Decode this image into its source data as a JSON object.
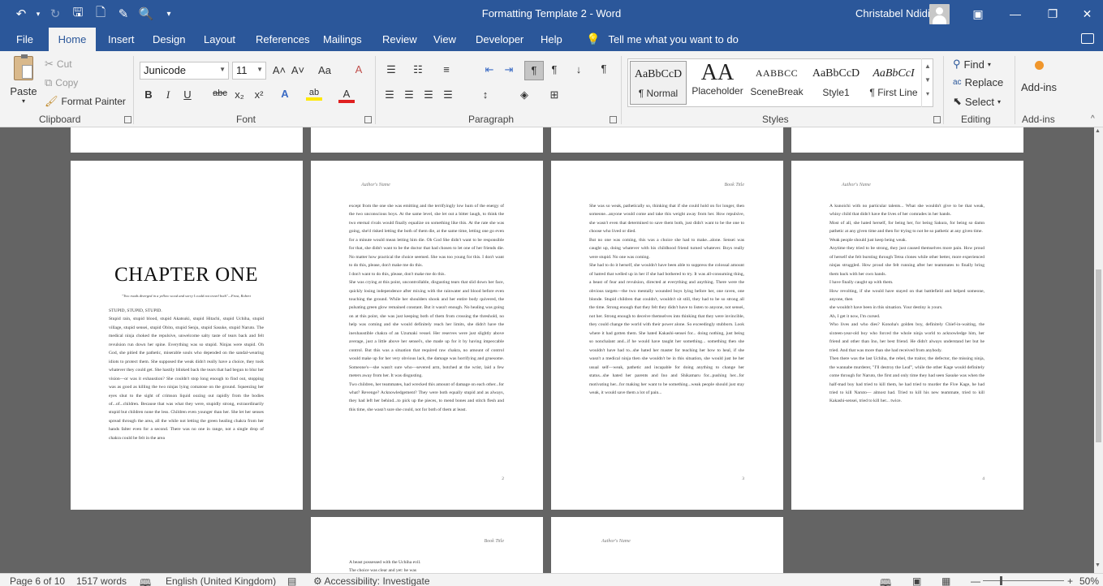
{
  "window": {
    "title": "Formatting Template 2  -  Word",
    "user": "Christabel Ndidi",
    "minimize": "—",
    "restore": "❐",
    "close": "✕",
    "ribbon_display": "▣"
  },
  "quick_access": {
    "undo": "↶",
    "undo_dd": "▾",
    "redo": "↻",
    "save": "🖫",
    "new": "🗋",
    "draw": "✎",
    "print_preview": "🔍",
    "customize": "▾"
  },
  "tabs": [
    "File",
    "Home",
    "Insert",
    "Design",
    "Layout",
    "References",
    "Mailings",
    "Review",
    "View",
    "Developer",
    "Help"
  ],
  "active_tab": "Home",
  "tell_me": "Tell me what you want to do",
  "clipboard": {
    "label": "Clipboard",
    "paste": "Paste",
    "cut": "Cut",
    "copy": "Copy",
    "format_painter": "Format Painter"
  },
  "font": {
    "label": "Font",
    "name": "Junicode",
    "size": "11",
    "bold": "B",
    "italic": "I",
    "underline": "U",
    "strikethrough": "abc",
    "subscript": "x₂",
    "superscript": "x²",
    "grow": "A˄",
    "shrink": "A˅",
    "case": "Aa",
    "clear": "A",
    "effects": "A",
    "highlight": "ab",
    "color": "A"
  },
  "paragraph": {
    "label": "Paragraph",
    "pilcrow": "¶"
  },
  "styles": {
    "label": "Styles",
    "items": [
      {
        "sample": "AaBbCcD",
        "name": "¶ Normal"
      },
      {
        "sample": "AA",
        "name": "Placeholder"
      },
      {
        "sample": "AABBCC",
        "name": "SceneBreak"
      },
      {
        "sample": "AaBbCcD",
        "name": "Style1"
      },
      {
        "sample": "AaBbCcI",
        "name": "¶ First Line"
      }
    ]
  },
  "editing": {
    "label": "Editing",
    "find": "Find",
    "replace": "Replace",
    "select": "Select"
  },
  "addins": {
    "label": "Add-ins",
    "button": "Add-ins"
  },
  "pages": [
    {
      "type": "chapter",
      "chapter_title": "CHAPTER ONE",
      "epigraph": "\"Two roads diverged in a yellow wood and sorry I could not travel both\"—Frost, Robert",
      "body": "STUPID, STUPID, STUPID.\n    Stupid rain, stupid blood, stupid Akatsuki, stupid Hitachi, stupid Uchiha, stupid village, stupid sensei, stupid Obito, stupid Senju, stupid Sasuke, stupid Naruto. The medical ninja choked the repulsive, unwelcome salty taste of tears back and felt revulsion run down her spine. Everything was so stupid. Ninjas were stupid. Oh God, she pitied the pathetic, miserable souls who depended on the sandal-wearing idiots to protect them. She supposed the weak didn't really have a choice, they took whatever they could get. She hastily blinked back the tears that had begun to blur her vision—or was it exhaustion? She couldn't stop long enough to find out, stopping was as good as killing the two ninjas lying comatose on the ground. Squeezing her eyes shut to the sight of crimson liquid oozing out rapidly from the bodies of...of...children. Because that was what they were, stupidly strong, extraordinarily stupid but children none the less. Children even younger than her. She let her senses spread through the area, all the while not letting the green healing chakra from her hands falter even for a second. There was no one in range, not a single drop of chakra could be felt in the area"
    },
    {
      "header": "Author's Name",
      "body": "except from the one she was emitting and the terrifyingly low hum of the energy of the two unconscious boys. At the same level, she let out a bitter laugh, to think the two eternal rivals would finally equalize on something like this. At the rate she was going, she'd risked letting the both of them die, at the same time, letting one go even for a minute would mean letting him die. Oh God She didn't want to be responsible for that, she didn't want to be the doctor that had chosen to let one of her friends die. No matter how practical the choice seemed. She was too young for this. I don't want to do this, please, don't make me do this.\n    I don't want to do this, please, don't make me do this.\n    She was crying at this point, uncontrollable, disgusting tears that slid down her face, quickly losing independence after mixing with the rainwater and blood before even touching the ground. While her shoulders shook and her entire body quivered, the pulsating green glow remained constant. But it wasn't enough. No healing was going on at this point, she was just keeping both of them from crossing the threshold, no help was coming and she would definitely reach her limits, she didn't have the inexhaustible chakra of an Uzumaki vessel. Her reserves were just slightly above average, just a little above her sensei's, she made up for it by having impeccable control. But this was a situation that required raw chakra, no amount of control would make up for her very obvious lack, the damage was horrifying and gruesome. Someone's—she wasn't sure who—severed arm, botched at the wrist, laid a few meters away from her. It was disgusting.\n    Two children, her teammates, had wrecked this amount of damage on each other...for what? Revenge? Acknowledgement? They were both equally stupid and as always, they had left her behind...to pick up the pieces, to mend bones and stitch flesh and this time, she wasn't sure she could, not for both of them at least.",
      "number": "2"
    },
    {
      "header": "Book Title",
      "body": "She was so weak, pathetically so, thinking that if she could hold on for longer, then someone...anyone would come and take this weight away from her. How repulsive, she wasn't even that determined to save them both, just didn't want to be the one to choose who lived or died.\n    But no one was coming, this was a choice she had to make...alone. Sensei was caught up, doing whatever with his childhood friend turned whatever. Boys really were stupid. No one was coming.\n    She had to do it herself, she wouldn't have been able to suppress the colossal amount of hatred that welled up in her if she had bothered to try. It was all-consuming thing, a beast of fear and revulsion, directed at everything and anything. There were the obvious targets—the two mentally wounded boys lying before her, one raven, one blonde. Stupid children that couldn't, wouldn't sit still, they had to be so strong all the time. Strong enough that they felt they didn't have to listen to anyone, not sensei, not her. Strong enough to deceive themselves into thinking that they were invincible, they could change the world with their power alone. So exceedingly stubborn. Look where it had gotten them. She hated Kakashi-sensei for... doing nothing, just being so nonchalant and...if he would have taught her something... something then she wouldn't have had to...she hated her master for teaching her how to heal, if she wasn't a medical ninja then she wouldn't be in this situation, she would just be her usual self—weak, pathetic and incapable for doing anything to change her status...she hated her parents and Ino and Shikamaru for...pushing her...for motivating her...for making her want to be something...weak people should just stay weak, it would save them a lot of pain...",
      "number": "3"
    },
    {
      "header": "Author's Name",
      "body": "    A kunoichi with no particular talents... What she wouldn't give to be that weak, whiny child that didn't have the lives of her comrades in her hands.\n    Most of all, she hated herself, for being her, for being Sakura, for being so damn pathetic at any given time and then for trying to not be so pathetic at any given time.\n    Weak people should just keep being weak.\n    Anytime they tried to be strong, they just caused themselves more pain. How proud of herself she felt bursting through Tetsu clones while other better, more experienced ninjas struggled. How proud she felt running after her teammates to finally bring them back with her own hands.\n    I have finally caught up with them.\n    How revolting, if she would have stayed on that battlefield and helped someone, anyone, then\n    she wouldn't have been in this situation. Your destiny is yours.\n    Ah, I get it now, I'm cursed.\n    Who lives and who dies? Konoha's golden boy, definitely Chief-in-waiting, the sixteen-year-old boy who forced the whole ninja world to acknowledge him, her friend and other than Ino, her best friend. He didn't always understand her but he tried. And that was more than she had received from anybody.\n    Then there was the last Uchiha, the rebel, the traitor, the defector, the missing ninja, the wannabe murderer, \"I'll destroy the Leaf\", while the other Kage would definitely come through for Naruto, the first and only time they had seen Sasuke was when the half-mad boy had tried to kill them, he had tried to murder the Five Kage, he had tried to kill Naruto— almost had. Tried to kill his new teammate, tried to kill Kakashi-sensei, tried to kill her... twice.",
      "number": "4"
    },
    {
      "header": "Book Title",
      "body": "    A beast possessed with the Uchiha evil.\n    The choice was clear and yet: he was"
    },
    {
      "header": "Author's Name",
      "body": ""
    }
  ],
  "status": {
    "page": "Page 6 of 10",
    "words": "1517 words",
    "language": "English (United Kingdom)",
    "accessibility": "Accessibility: Investigate",
    "zoom": "50%",
    "zoom_minus": "—",
    "zoom_plus": "+"
  }
}
